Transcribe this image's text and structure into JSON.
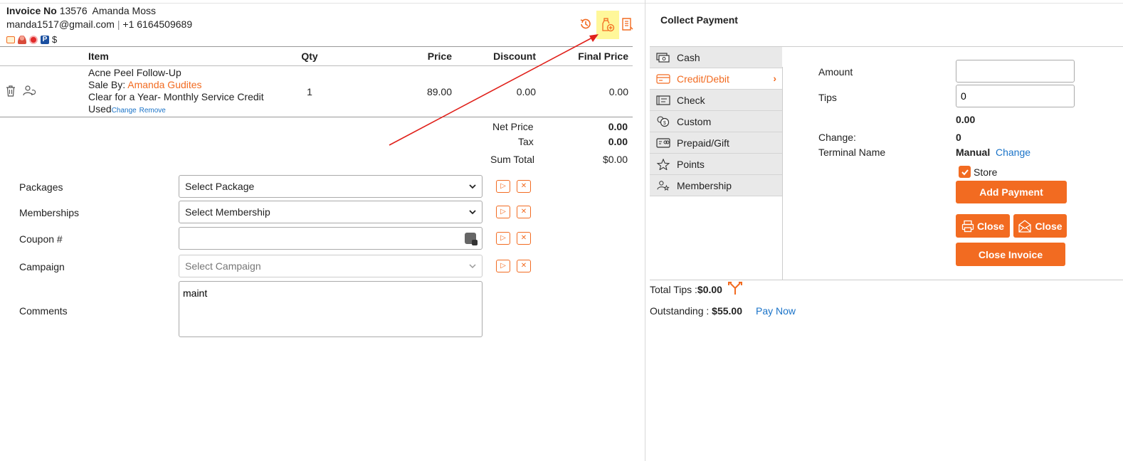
{
  "invoice": {
    "label": "Invoice No",
    "number": "13576",
    "customer_name": "Amanda Moss",
    "email": "manda1517@gmail.com",
    "separator": "|",
    "phone": "+1 6164509689",
    "dollar": "$"
  },
  "table": {
    "headers": [
      "Item",
      "Qty",
      "Price",
      "Discount",
      "Final Price"
    ],
    "row": {
      "item_name": "Acne Peel Follow-Up",
      "sale_by_label": "Sale By:",
      "sale_by": "Amanda Gudites",
      "credit_line": "Clear for a Year- Monthly Service Credit",
      "used": "Used",
      "change_link": "Change",
      "remove_link": "Remove",
      "qty": "1",
      "price": "89.00",
      "discount": "0.00",
      "final_price": "0.00"
    }
  },
  "totals": {
    "net_price_label": "Net Price",
    "net_price": "0.00",
    "tax_label": "Tax",
    "tax": "0.00",
    "sum_total_label": "Sum Total",
    "sum_total": "$0.00"
  },
  "form": {
    "packages_label": "Packages",
    "packages_value": "Select Package",
    "memberships_label": "Memberships",
    "memberships_value": "Select Membership",
    "coupon_label": "Coupon #",
    "coupon_value": "",
    "campaign_label": "Campaign",
    "campaign_value": "Select Campaign",
    "comments_label": "Comments",
    "comments_value": "maint"
  },
  "payment": {
    "title": "Collect Payment",
    "methods": [
      "Cash",
      "Credit/Debit",
      "Check",
      "Custom",
      "Prepaid/Gift",
      "Points",
      "Membership"
    ],
    "active_method": "Credit/Debit",
    "amount_label": "Amount",
    "amount_value": "",
    "tips_label": "Tips",
    "tips_value": "0",
    "computed_value": "0.00",
    "change_label": "Change:",
    "change_value": "0",
    "terminal_label": "Terminal Name",
    "terminal_value": "Manual",
    "terminal_change_link": "Change",
    "store_label": "Store",
    "store_checked": true,
    "add_payment_button": "Add Payment",
    "close_print_button": "Close",
    "close_email_button": "Close",
    "close_invoice_button": "Close Invoice",
    "total_tips_label": "Total Tips :",
    "total_tips_value": "$0.00",
    "outstanding_label": "Outstanding :",
    "outstanding_value": "$55.00",
    "pay_now_link": "Pay Now"
  },
  "colors": {
    "accent": "#f26b21",
    "link": "#1a73c8",
    "annotation_arrow": "#e0201a",
    "highlight": "#fff79a"
  }
}
